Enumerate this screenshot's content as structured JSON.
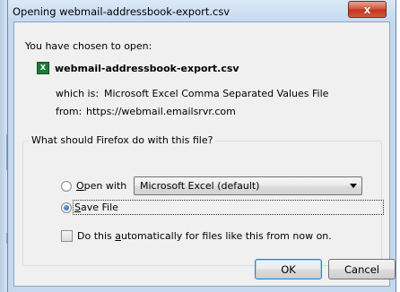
{
  "window": {
    "title": "Opening webmail-addressbook-export.csv",
    "close_label": "x"
  },
  "intro": {
    "heading": "You have chosen to open:",
    "file_icon_text": "X",
    "file_name": "webmail-addressbook-export.csv",
    "which_is_label": "which is:",
    "which_is_value": "Microsoft Excel Comma Separated Values File",
    "from_label": "from:",
    "from_value": "https://webmail.emailsrvr.com"
  },
  "options": {
    "legend": "What should Firefox do with this file?",
    "open_with": {
      "label_hotkey": "O",
      "label_rest": "pen with",
      "selected_app": "Microsoft Excel (default)",
      "checked": false
    },
    "save_file": {
      "label_hotkey": "S",
      "label_rest": "ave File",
      "checked": true
    },
    "auto": {
      "label_before": "Do this ",
      "label_hotkey": "a",
      "label_rest": "utomatically for files like this from now on.",
      "checked": false
    }
  },
  "buttons": {
    "ok": "OK",
    "cancel": "Cancel"
  }
}
